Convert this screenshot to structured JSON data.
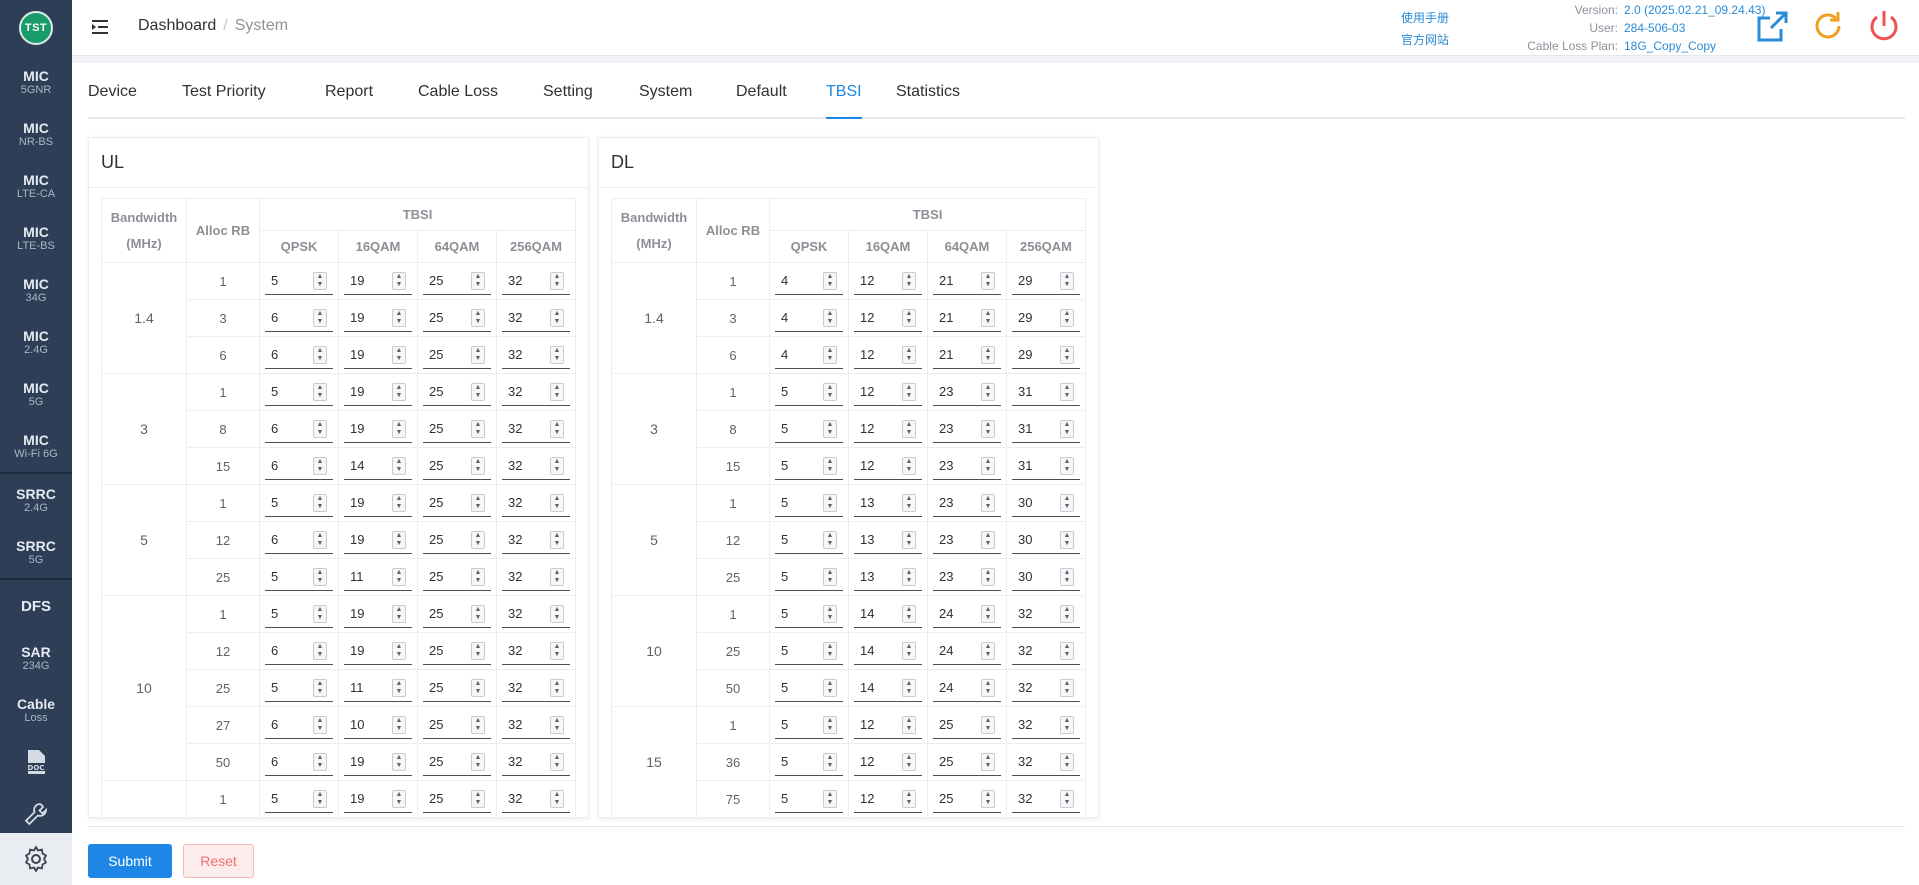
{
  "logo_text": "TST",
  "sidebar": {
    "items": [
      {
        "title": "MIC",
        "sub": "5GNR"
      },
      {
        "title": "MIC",
        "sub": "NR-BS"
      },
      {
        "title": "MIC",
        "sub": "LTE-CA"
      },
      {
        "title": "MIC",
        "sub": "LTE-BS"
      },
      {
        "title": "MIC",
        "sub": "34G"
      },
      {
        "title": "MIC",
        "sub": "2.4G"
      },
      {
        "title": "MIC",
        "sub": "5G"
      },
      {
        "title": "MIC",
        "sub": "Wi-Fi 6G"
      },
      {
        "title": "SRRC",
        "sub": "2.4G"
      },
      {
        "title": "SRRC",
        "sub": "5G"
      },
      {
        "title": "DFS",
        "sub": ""
      },
      {
        "title": "SAR",
        "sub": "234G"
      },
      {
        "title": "Cable",
        "sub": "Loss"
      }
    ],
    "doc_icon": "doc-icon",
    "tool_icon": "wrench-icon",
    "settings_icon": "gear-icon"
  },
  "header": {
    "breadcrumb": [
      "Dashboard",
      "System"
    ],
    "links": [
      "使用手册",
      "官方网站"
    ],
    "info": [
      {
        "label": "Version:",
        "value": "2.0 (2025.02.21_09.24.43)"
      },
      {
        "label": "User:",
        "value": "284-506-03"
      },
      {
        "label": "Cable Loss Plan:",
        "value": "18G_Copy_Copy"
      }
    ],
    "icons": [
      "export-icon",
      "refresh-icon",
      "power-icon"
    ],
    "colors": {
      "export": "#2a8bd6",
      "refresh": "#f0a020",
      "power": "#ef5350"
    }
  },
  "tabs": [
    "Device",
    "Test Priority",
    "Report",
    "Cable Loss",
    "Setting",
    "System",
    "Default",
    "TBSI",
    "Statistics"
  ],
  "active_tab": "TBSI",
  "headers": {
    "bandwidth": "Bandwidth (MHz)",
    "alloc_rb": "Alloc RB",
    "tbsi": "TBSI",
    "mods": [
      "QPSK",
      "16QAM",
      "64QAM",
      "256QAM"
    ]
  },
  "ul": {
    "title": "UL",
    "groups": [
      {
        "bw": "1.4",
        "rows": [
          {
            "rb": "1",
            "v": [
              "5",
              "19",
              "25",
              "32"
            ]
          },
          {
            "rb": "3",
            "v": [
              "6",
              "19",
              "25",
              "32"
            ]
          },
          {
            "rb": "6",
            "v": [
              "6",
              "19",
              "25",
              "32"
            ]
          }
        ]
      },
      {
        "bw": "3",
        "rows": [
          {
            "rb": "1",
            "v": [
              "5",
              "19",
              "25",
              "32"
            ]
          },
          {
            "rb": "8",
            "v": [
              "6",
              "19",
              "25",
              "32"
            ]
          },
          {
            "rb": "15",
            "v": [
              "6",
              "14",
              "25",
              "32"
            ]
          }
        ]
      },
      {
        "bw": "5",
        "rows": [
          {
            "rb": "1",
            "v": [
              "5",
              "19",
              "25",
              "32"
            ]
          },
          {
            "rb": "12",
            "v": [
              "6",
              "19",
              "25",
              "32"
            ]
          },
          {
            "rb": "25",
            "v": [
              "5",
              "11",
              "25",
              "32"
            ]
          }
        ]
      },
      {
        "bw": "10",
        "rows": [
          {
            "rb": "1",
            "v": [
              "5",
              "19",
              "25",
              "32"
            ]
          },
          {
            "rb": "12",
            "v": [
              "6",
              "19",
              "25",
              "32"
            ]
          },
          {
            "rb": "25",
            "v": [
              "5",
              "11",
              "25",
              "32"
            ]
          },
          {
            "rb": "27",
            "v": [
              "6",
              "10",
              "25",
              "32"
            ]
          },
          {
            "rb": "50",
            "v": [
              "6",
              "19",
              "25",
              "32"
            ]
          }
        ]
      },
      {
        "bw": "",
        "rows": [
          {
            "rb": "1",
            "v": [
              "5",
              "19",
              "25",
              "32"
            ]
          }
        ]
      }
    ]
  },
  "dl": {
    "title": "DL",
    "groups": [
      {
        "bw": "1.4",
        "rows": [
          {
            "rb": "1",
            "v": [
              "4",
              "12",
              "21",
              "29"
            ]
          },
          {
            "rb": "3",
            "v": [
              "4",
              "12",
              "21",
              "29"
            ]
          },
          {
            "rb": "6",
            "v": [
              "4",
              "12",
              "21",
              "29"
            ]
          }
        ]
      },
      {
        "bw": "3",
        "rows": [
          {
            "rb": "1",
            "v": [
              "5",
              "12",
              "23",
              "31"
            ]
          },
          {
            "rb": "8",
            "v": [
              "5",
              "12",
              "23",
              "31"
            ]
          },
          {
            "rb": "15",
            "v": [
              "5",
              "12",
              "23",
              "31"
            ]
          }
        ]
      },
      {
        "bw": "5",
        "rows": [
          {
            "rb": "1",
            "v": [
              "5",
              "13",
              "23",
              "30"
            ]
          },
          {
            "rb": "12",
            "v": [
              "5",
              "13",
              "23",
              "30"
            ]
          },
          {
            "rb": "25",
            "v": [
              "5",
              "13",
              "23",
              "30"
            ]
          }
        ]
      },
      {
        "bw": "10",
        "rows": [
          {
            "rb": "1",
            "v": [
              "5",
              "14",
              "24",
              "32"
            ]
          },
          {
            "rb": "25",
            "v": [
              "5",
              "14",
              "24",
              "32"
            ]
          },
          {
            "rb": "50",
            "v": [
              "5",
              "14",
              "24",
              "32"
            ]
          }
        ]
      },
      {
        "bw": "15",
        "rows": [
          {
            "rb": "1",
            "v": [
              "5",
              "12",
              "25",
              "32"
            ]
          },
          {
            "rb": "36",
            "v": [
              "5",
              "12",
              "25",
              "32"
            ]
          },
          {
            "rb": "75",
            "v": [
              "5",
              "12",
              "25",
              "32"
            ]
          }
        ]
      }
    ]
  },
  "buttons": {
    "submit": "Submit",
    "reset": "Reset"
  }
}
